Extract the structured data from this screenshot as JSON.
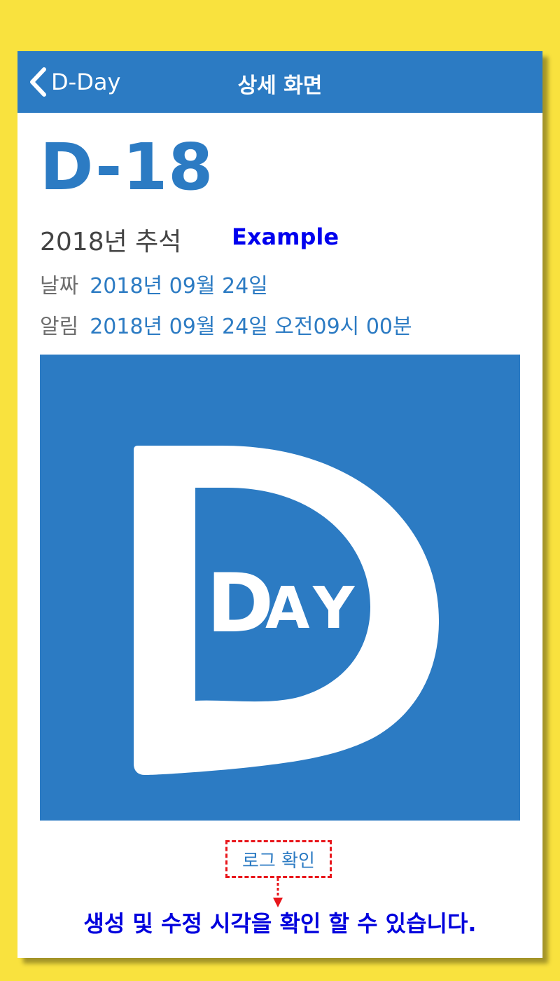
{
  "navbar": {
    "back_label": "D-Day",
    "title": "상세 화면"
  },
  "detail": {
    "dday": "D-18",
    "event_name": "2018년 추석",
    "date_label": "날짜",
    "date_value": "2018년 09월 24일",
    "alarm_label": "알림",
    "alarm_value": "2018년 09월 24일 오전09시 00분"
  },
  "image": {
    "icon": "dday-logo",
    "letters": [
      "D",
      "A",
      "Y"
    ]
  },
  "log_button": {
    "label": "로그 확인"
  },
  "annotations": {
    "example_label": "Example",
    "caption": "생성 및 수정 시각을 확인 할 수 있습니다."
  },
  "colors": {
    "background": "#F9E23E",
    "accent": "#2C7BC3",
    "annotation_text": "#0000DD",
    "annotation_border": "#E8161B"
  }
}
